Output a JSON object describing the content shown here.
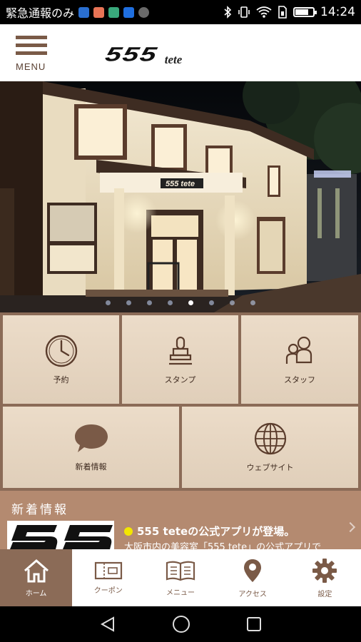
{
  "status_bar": {
    "left_text": "緊急通報のみ",
    "time": "14:24",
    "app_icons": [
      "message-app-icon",
      "photo-app-icon",
      "gallery-app-icon",
      "dropbox-app-icon",
      "drive-app-icon"
    ],
    "right_icons": [
      "bluetooth-icon",
      "vibrate-icon",
      "wifi-icon",
      "sim-icon",
      "battery-icon"
    ]
  },
  "header": {
    "menu_label": "MENU",
    "logo_main": "555",
    "logo_sub": "tete"
  },
  "hero": {
    "slide_count": 8,
    "active_slide": 4
  },
  "grid": {
    "items": [
      {
        "label": "予約",
        "icon": "clock-icon"
      },
      {
        "label": "スタンプ",
        "icon": "stamp-icon"
      },
      {
        "label": "スタッフ",
        "icon": "staff-icon"
      },
      {
        "label": "新着情報",
        "icon": "speech-bubble-icon"
      },
      {
        "label": "ウェブサイト",
        "icon": "globe-icon"
      }
    ]
  },
  "news": {
    "section_title": "新着情報",
    "item_title": "555 teteの公式アプリが登場。",
    "item_text": "大阪市内の美容室「555 tete」の公式アプリで"
  },
  "tabbar": {
    "tabs": [
      {
        "label": "ホーム",
        "icon": "home-icon",
        "active": true
      },
      {
        "label": "クーポン",
        "icon": "coupon-icon",
        "active": false
      },
      {
        "label": "メニュー",
        "icon": "menu-book-icon",
        "active": false
      },
      {
        "label": "アクセス",
        "icon": "map-pin-icon",
        "active": false
      },
      {
        "label": "設定",
        "icon": "gear-icon",
        "active": false
      }
    ]
  },
  "colors": {
    "brand_brown": "#8b6b57",
    "tile_beige": "#e9d7c1",
    "news_bg": "#b48a70",
    "bullet_yellow": "#f3e600"
  }
}
